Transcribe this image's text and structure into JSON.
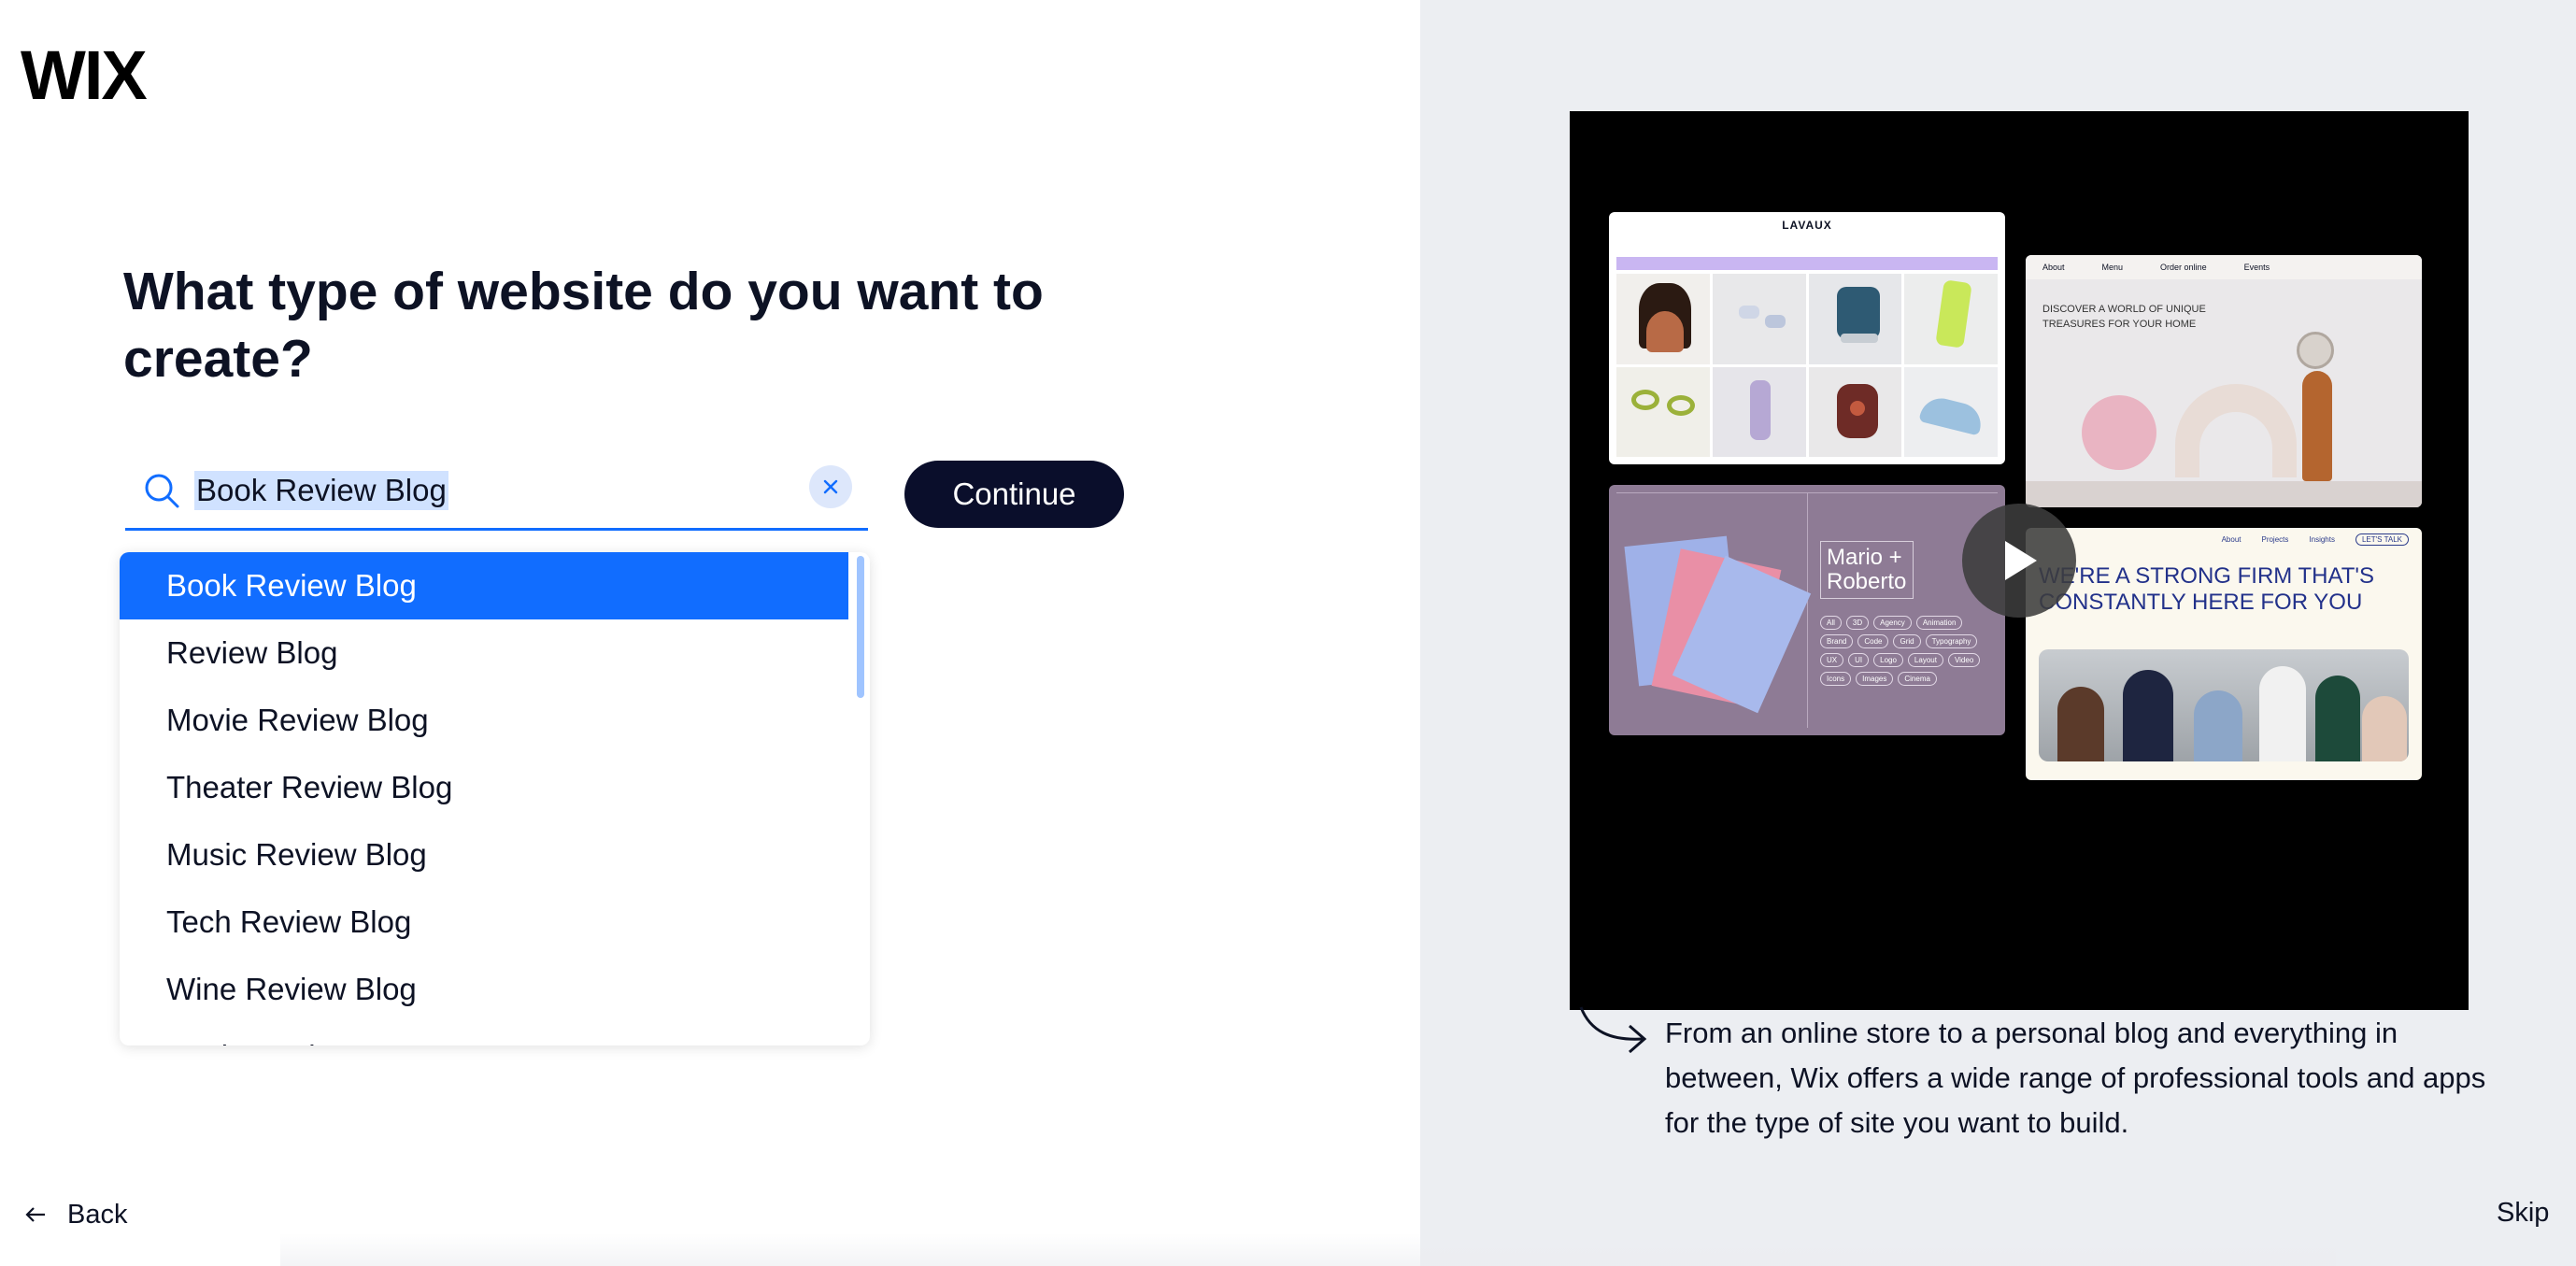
{
  "brand": {
    "logo_text": "WIX"
  },
  "page": {
    "heading": "What type of website do you want to create?",
    "continue_label": "Continue",
    "back_label": "Back",
    "skip_label": "Skip"
  },
  "search": {
    "value": "Book Review Blog",
    "accent_color": "#116dff"
  },
  "dropdown": {
    "items": [
      "Book Review Blog",
      "Review Blog",
      "Movie Review Blog",
      "Theater Review Blog",
      "Music Review Blog",
      "Tech Review Blog",
      "Wine Review Blog",
      "Book Fandom"
    ],
    "active_index": 0
  },
  "preview": {
    "caption": "From an online store to a personal blog and everything in between, Wix offers a wide range of professional tools and apps for the type of site you want to build.",
    "cards": {
      "store_name": "LAVAUX",
      "home_nav": [
        "About",
        "Menu",
        "Order online",
        "Events"
      ],
      "home_headline": "DISCOVER A WORLD OF UNIQUE TREASURES FOR YOUR HOME",
      "portfolio_title": "Mario + Roberto",
      "portfolio_tags": [
        "All",
        "3D",
        "Agency",
        "Animation",
        "Brand",
        "Code",
        "Grid",
        "Typography",
        "UX",
        "UI",
        "Logo",
        "Layout",
        "Video",
        "Icons",
        "Images",
        "Cinema"
      ],
      "firm_nav": [
        "About",
        "Projects",
        "Insights",
        "LET'S TALK"
      ],
      "firm_headline": "WE'RE A STRONG FIRM THAT'S CONSTANTLY HERE FOR YOU"
    }
  }
}
